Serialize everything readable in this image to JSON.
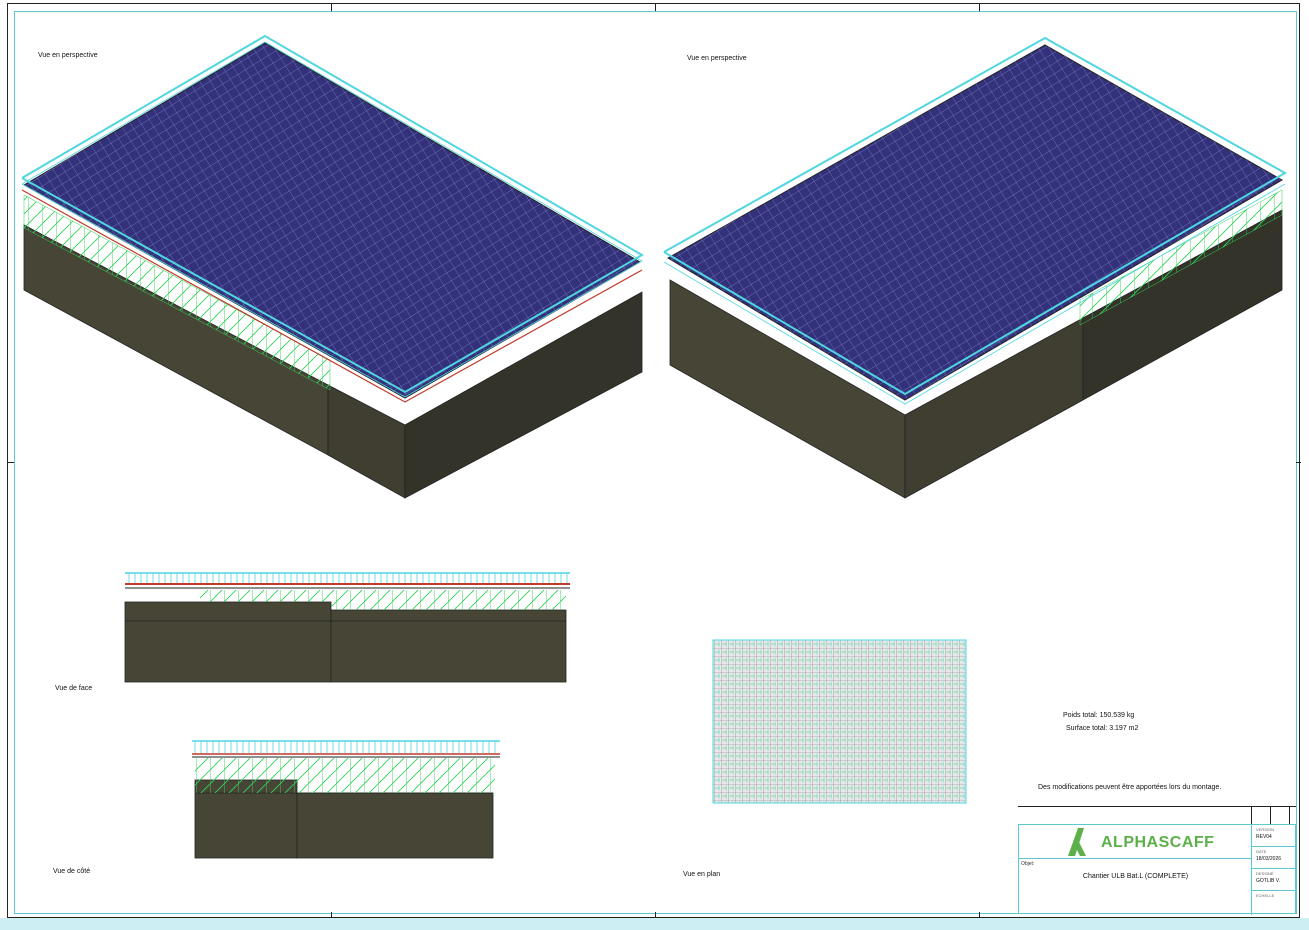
{
  "views": {
    "perspective_left_label": "Vue en perspective",
    "perspective_right_label": "Vue en perspective",
    "front_label": "Vue de face",
    "side_label": "Vue de côté",
    "plan_label": "Vue en plan"
  },
  "summary": {
    "weight": "Poids total: 150.539 kg",
    "surface": "Surface total: 3.197 m2",
    "note": "Des modifications peuvent être apportées lors du montage."
  },
  "title_block": {
    "brand": "ALPHASCAFF",
    "object_label": "Objet:",
    "object_value": "Chantier ULB Bat.L (COMPLETE)",
    "fields": [
      {
        "key": "VERSION",
        "value": "REV04"
      },
      {
        "key": "DATE",
        "value": "18/03/2026"
      },
      {
        "key": "DESSINÉ",
        "value": "GOTLIB V."
      },
      {
        "key": "ECHELLE",
        "value": ""
      }
    ]
  },
  "colors": {
    "roof": "#32317a",
    "roof_grid": "#7a7ec6",
    "wall": "#474636",
    "wall_dark": "#34332a",
    "scaffold_cyan": "#4fd6e0",
    "scaffold_green": "#33d05a",
    "rail_red": "#c0392b",
    "frame_cyan": "#5ec8d0",
    "brand_green": "#5cb04a"
  }
}
